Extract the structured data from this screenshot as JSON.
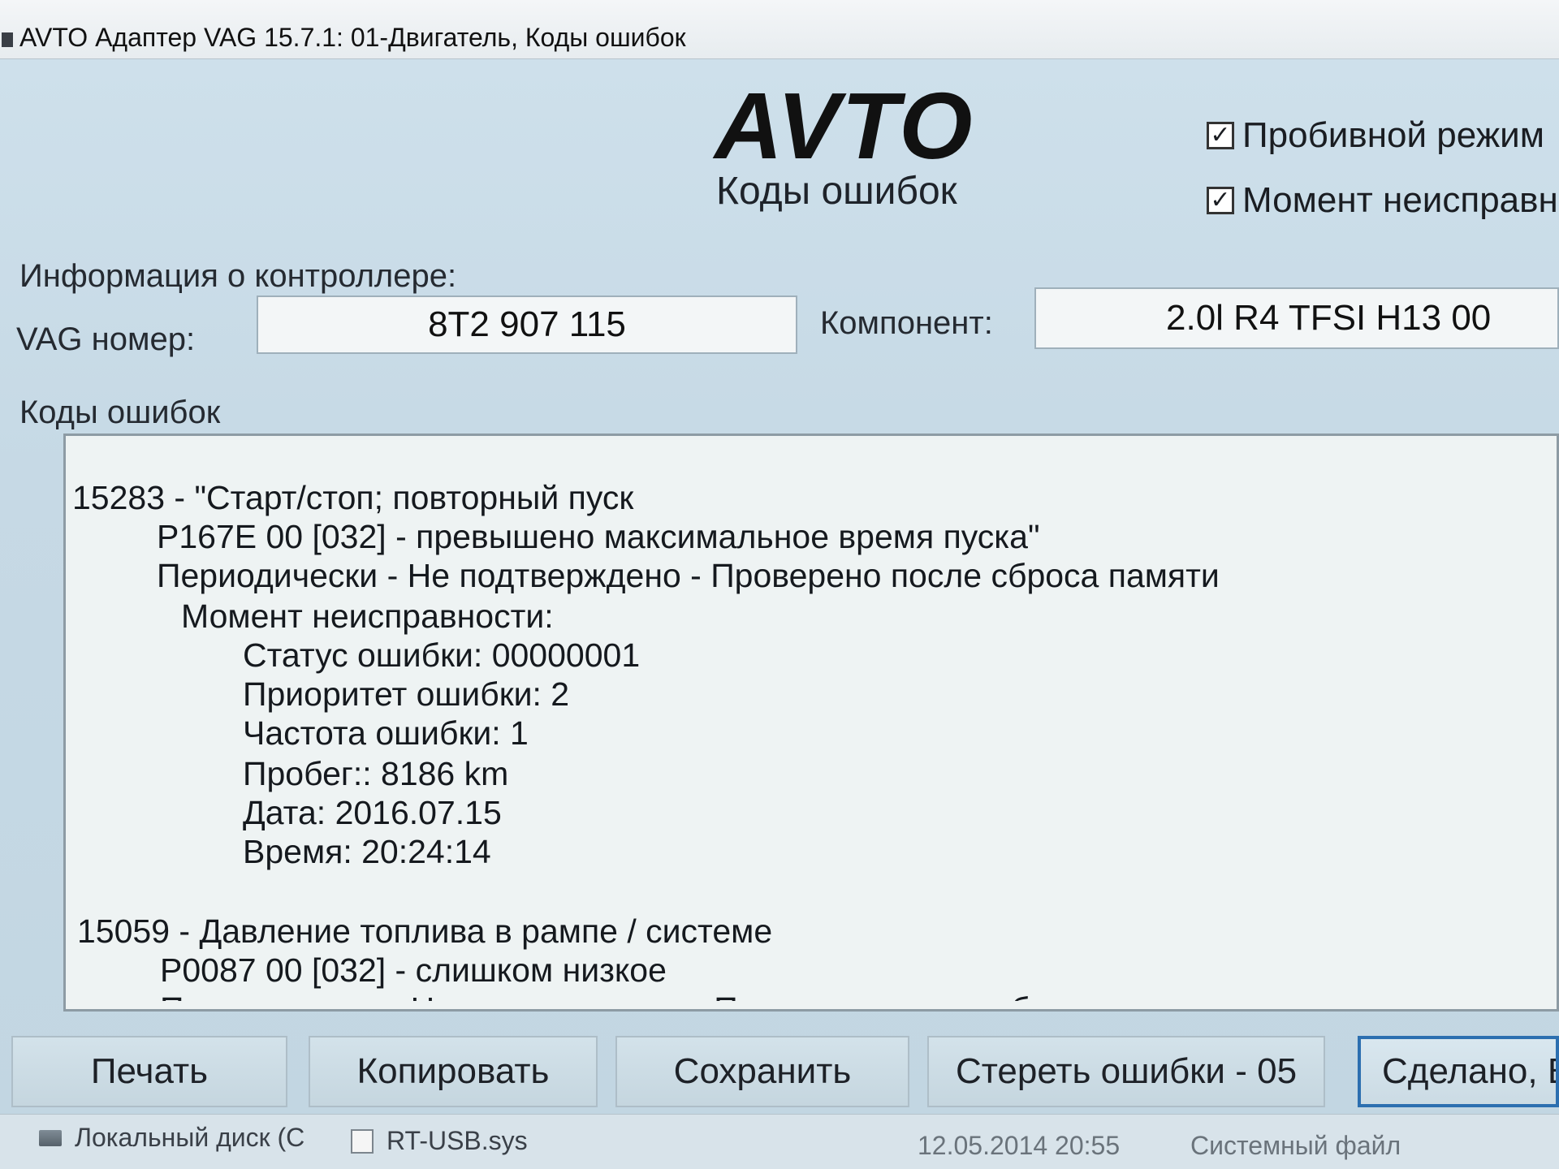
{
  "window": {
    "title": "AVTO Адаптер VAG 15.7.1: 01-Двигатель,  Коды ошибок"
  },
  "header": {
    "brand": "AVTO",
    "subtitle": "Коды ошибок"
  },
  "options": [
    {
      "label": "Пробивной режим",
      "checked": true
    },
    {
      "label": "Момент неисправн",
      "checked": true
    }
  ],
  "controller": {
    "section_label": "Информация о контроллере:",
    "vag_label": "VAG номер:",
    "vag_value": "8T2 907 115",
    "component_label": "Компонент:",
    "component_value": "2.0l R4 TFSI   H13 00"
  },
  "codes": {
    "section_label": "Коды ошибок",
    "lines": [
      "15283 - \"Старт/стоп; повторный пуск",
      "P167E 00 [032] - превышено максимальное время пуска\"",
      "Периодически - Не подтверждено - Проверено после сброса памяти",
      "Момент неисправности:",
      "Статус ошибки: 00000001",
      "Приоритет ошибки: 2",
      "Частота ошибки: 1",
      "Пробег:: 8186 km",
      "Дата: 2016.07.15",
      "Время: 20:24:14",
      "15059 - Давление топлива в рампе / системе",
      "P0087 00 [032] - слишком низкое",
      "Периодически - Не подтверждено - Проверено после сброса памяти"
    ]
  },
  "buttons": {
    "print": "Печать",
    "copy": "Копировать",
    "save": "Сохранить",
    "clear": "Стереть ошибки - 05",
    "done": "Сделано, В"
  },
  "taskbar": {
    "drive_label": "Локальный диск (C",
    "file_name": "RT-USB.sys",
    "file_date": "12.05.2014 20:55",
    "file_type": "Системный файл"
  }
}
